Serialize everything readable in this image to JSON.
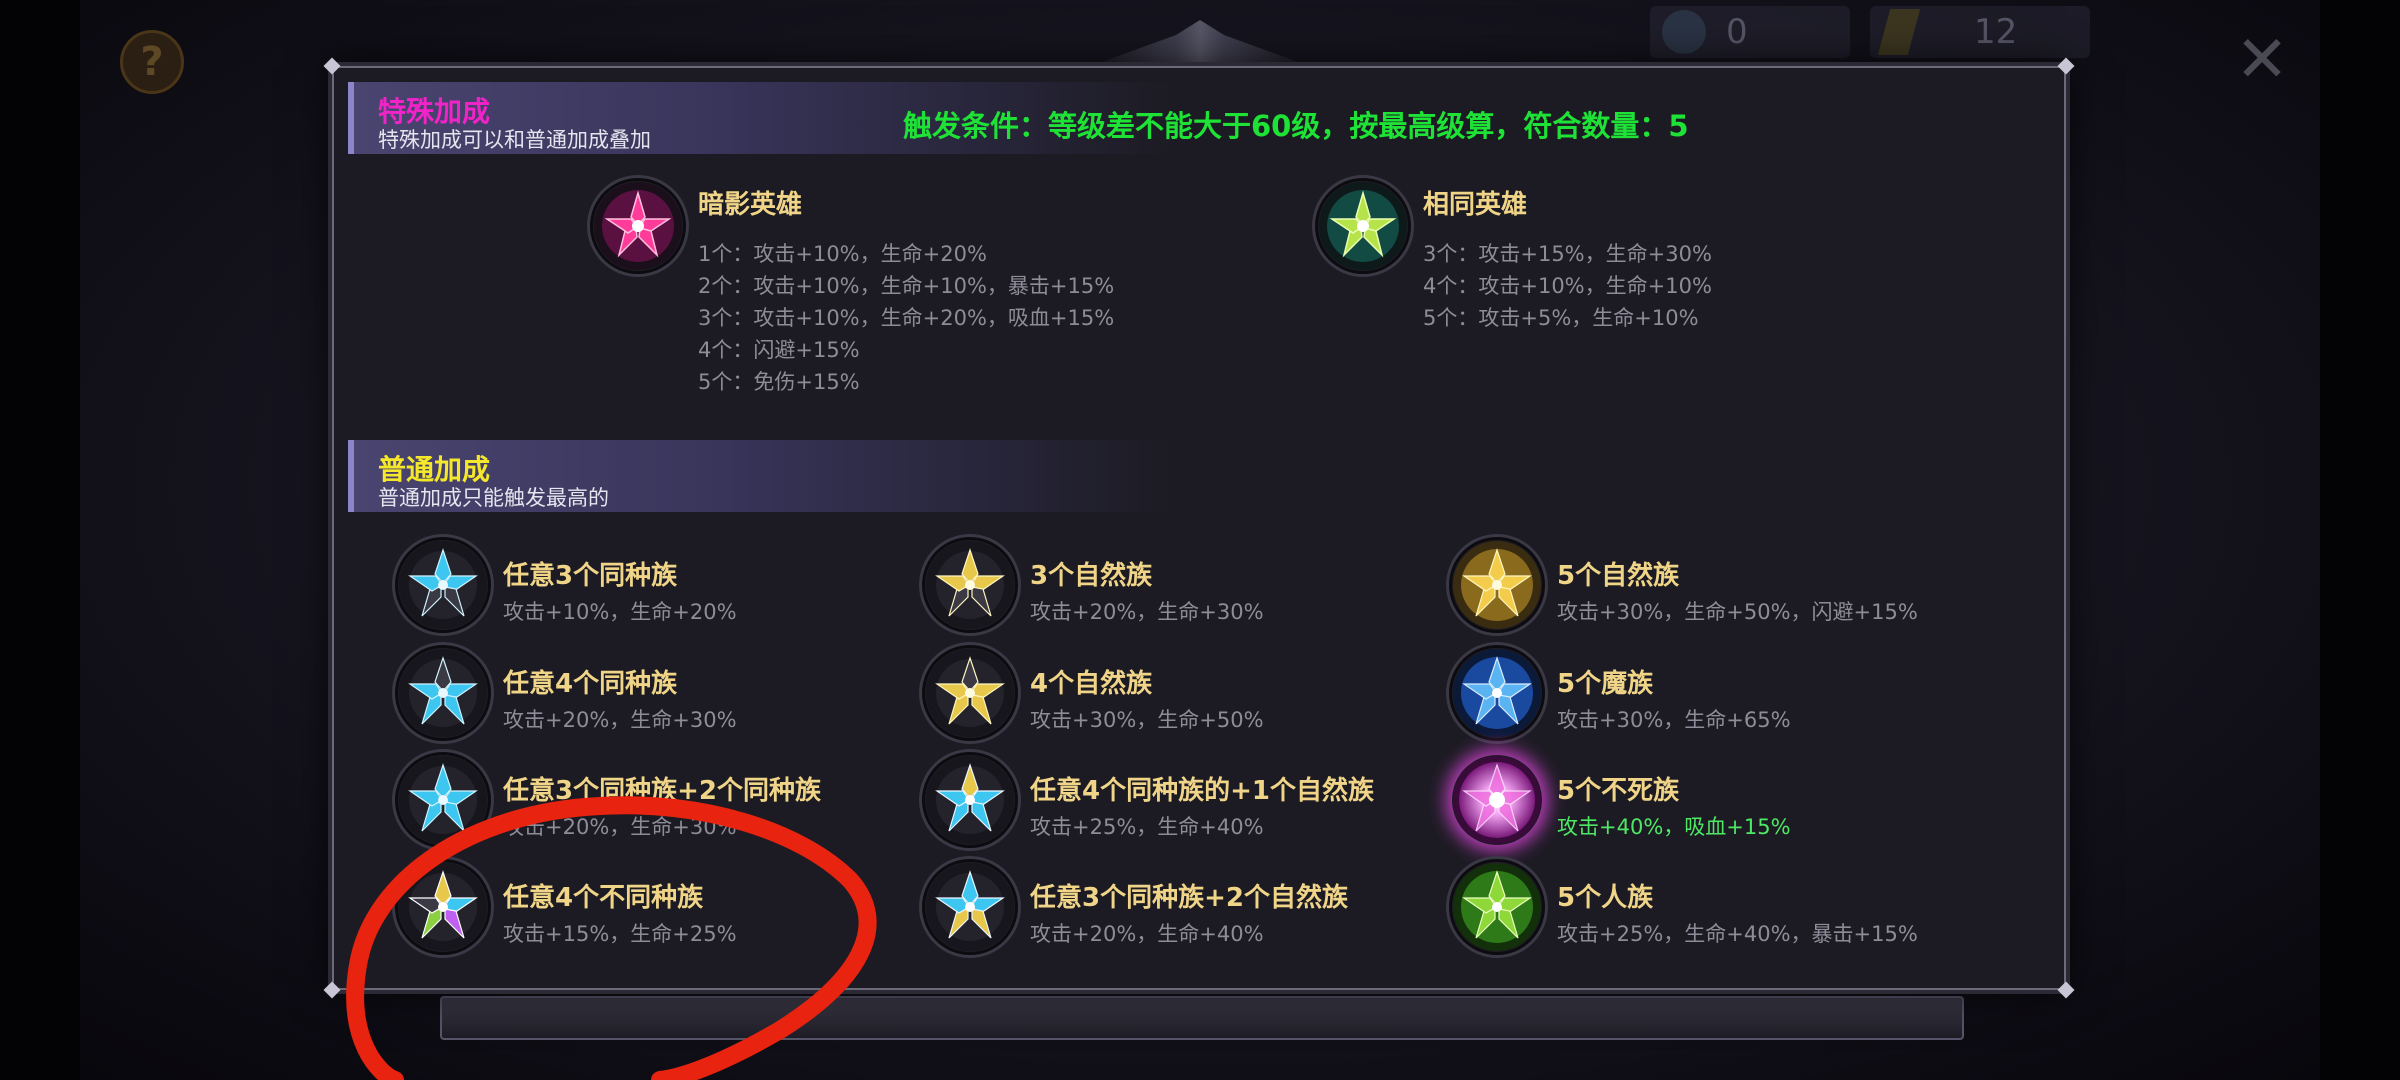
{
  "top_bar": {
    "currency_1": "0",
    "currency_2": "12"
  },
  "special": {
    "title": "特殊加成",
    "subtitle": "特殊加成可以和普通加成叠加",
    "trigger": "触发条件：等级差不能大于60级，按最高级算，符合数量：5",
    "bonuses": [
      {
        "name": "暗影英雄",
        "lines": [
          "1个：攻击+10%，生命+20%",
          "2个：攻击+10%，生命+10%，暴击+15%",
          "3个：攻击+10%，生命+20%，吸血+15%",
          "4个：闪避+15%",
          "5个：免伤+15%"
        ]
      },
      {
        "name": "相同英雄",
        "lines": [
          "3个：攻击+15%，生命+30%",
          "4个：攻击+10%，生命+10%",
          "5个：攻击+5%，生命+10%"
        ]
      }
    ]
  },
  "normal": {
    "title": "普通加成",
    "subtitle": "普通加成只能触发最高的",
    "items": [
      {
        "name": "任意3个同种族",
        "desc": "攻击+10%，生命+20%"
      },
      {
        "name": "3个自然族",
        "desc": "攻击+20%，生命+30%"
      },
      {
        "name": "5个自然族",
        "desc": "攻击+30%，生命+50%，闪避+15%"
      },
      {
        "name": "任意4个同种族",
        "desc": "攻击+20%，生命+30%"
      },
      {
        "name": "4个自然族",
        "desc": "攻击+30%，生命+50%"
      },
      {
        "name": "5个魔族",
        "desc": "攻击+30%，生命+65%"
      },
      {
        "name": "任意3个同种族+2个同种族",
        "desc": "攻击+20%，生命+30%"
      },
      {
        "name": "任意4个同种族的+1个自然族",
        "desc": "攻击+25%，生命+40%"
      },
      {
        "name": "5个不死族",
        "desc": "攻击+40%，吸血+15%"
      },
      {
        "name": "任意4个不同种族",
        "desc": "攻击+15%，生命+25%"
      },
      {
        "name": "任意3个同种族+2个自然族",
        "desc": "攻击+20%，生命+40%"
      },
      {
        "name": "5个人族",
        "desc": "攻击+25%，生命+40%，暴击+15%"
      }
    ]
  },
  "colors": {
    "special_title": "#f023c8",
    "normal_title": "#f5e82a",
    "trigger": "#1ee336",
    "item_name": "#f0d488",
    "item_desc": "#8e8c98",
    "active_desc": "#4ee864",
    "annotation": "#e8230f"
  }
}
